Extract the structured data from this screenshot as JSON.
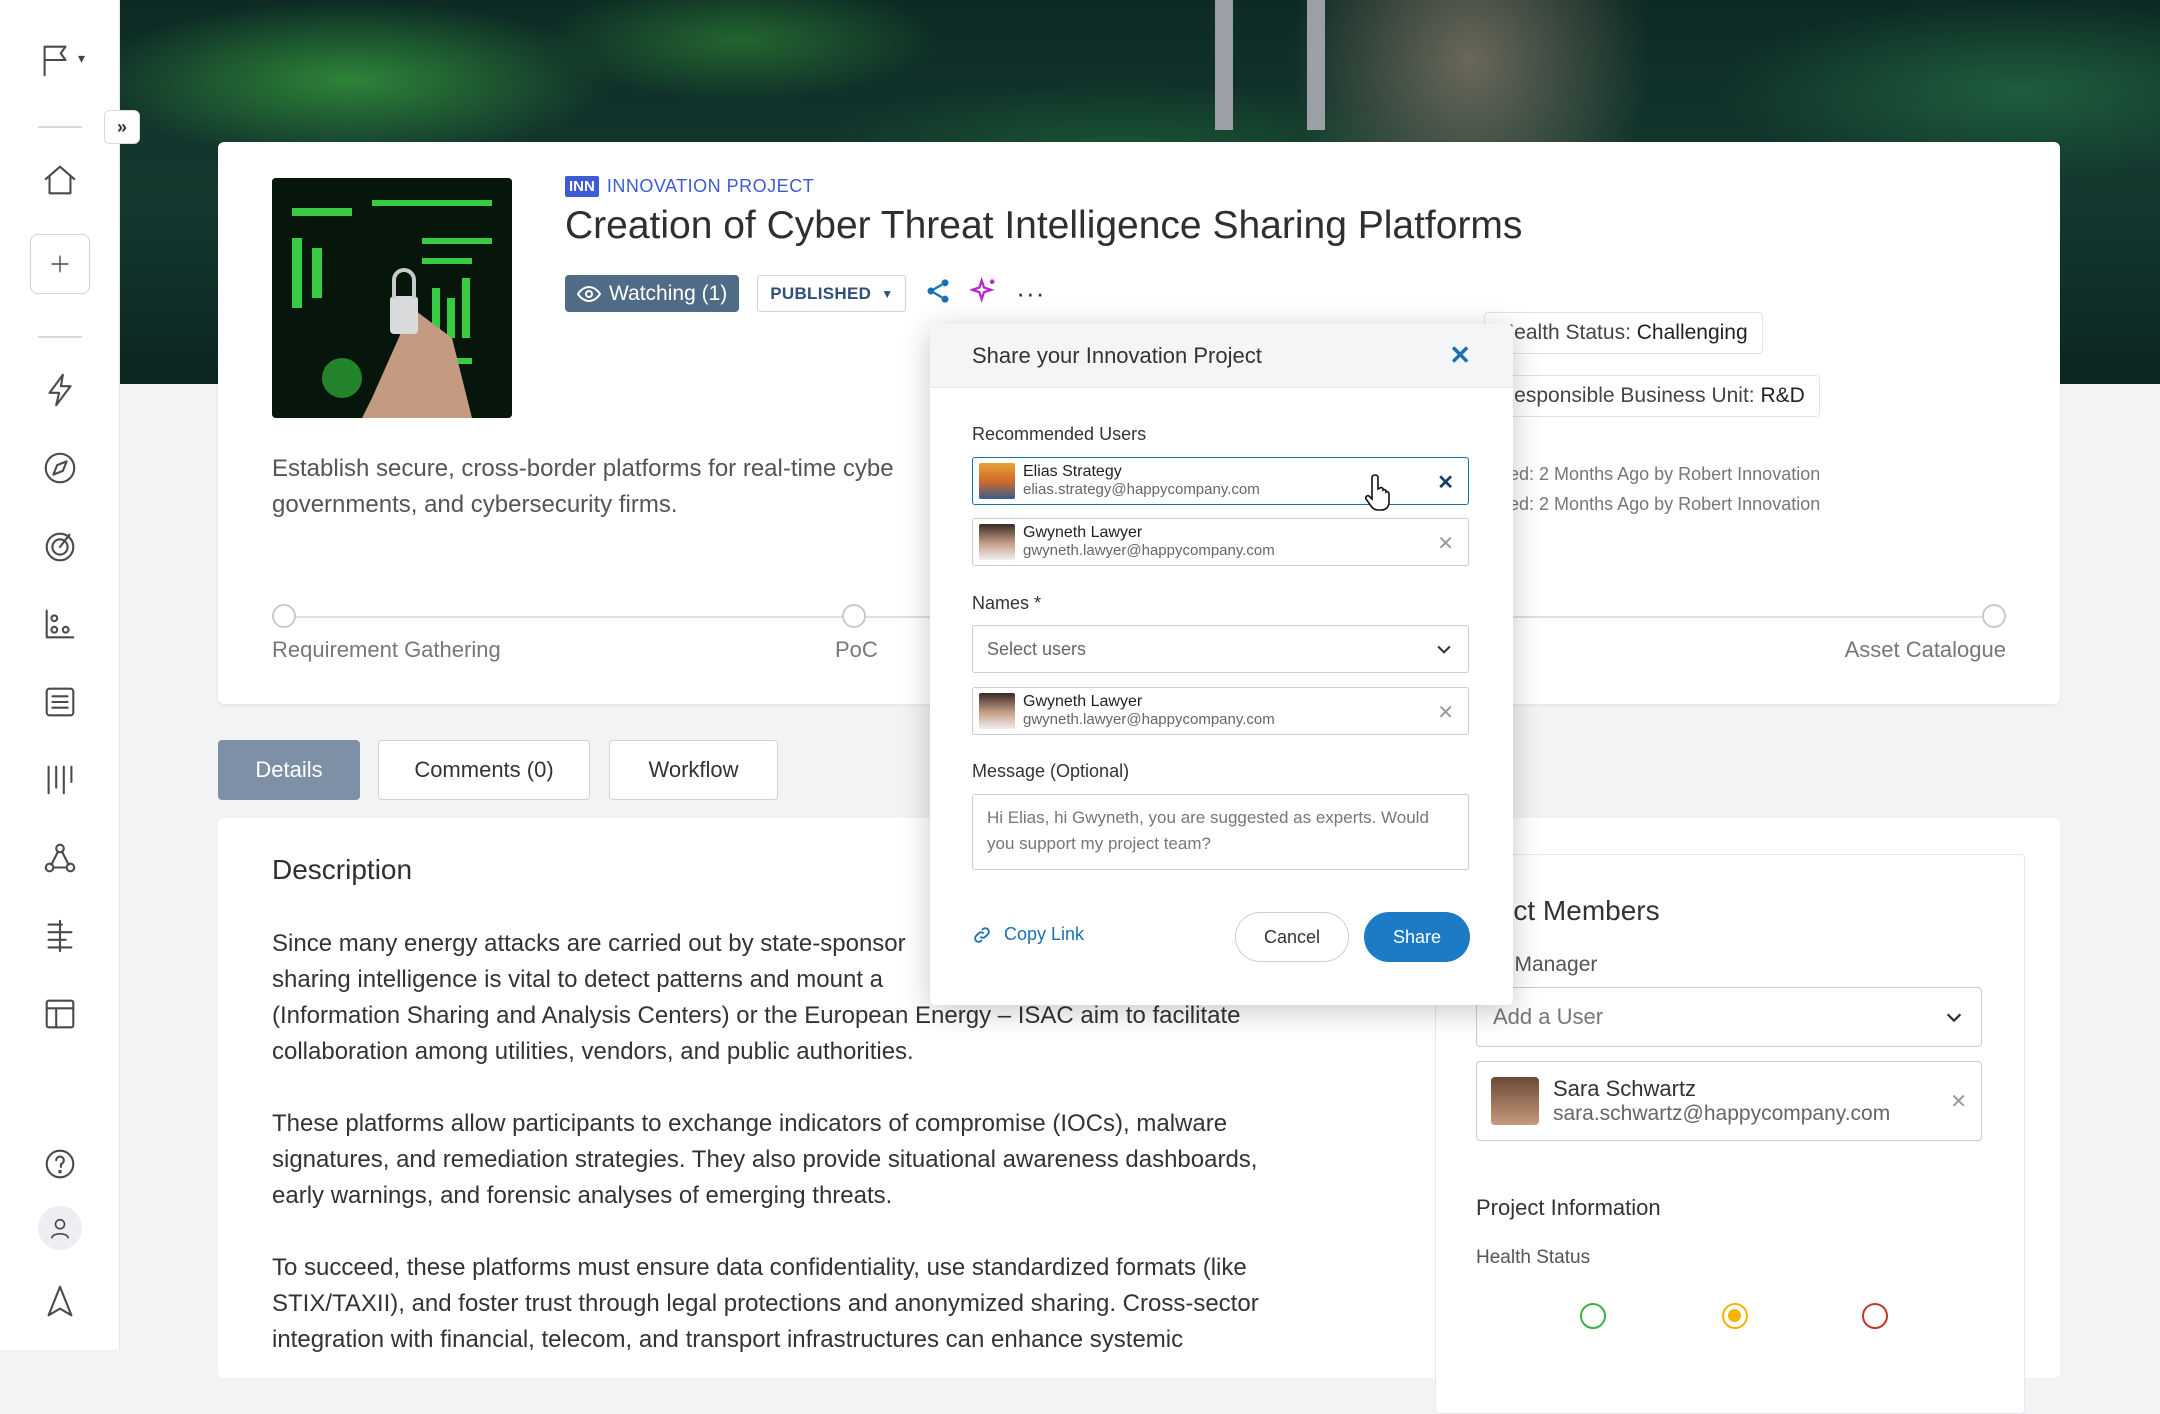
{
  "project": {
    "type_badge": "INN",
    "type_label": "INNOVATION PROJECT",
    "title": "Creation of Cyber Threat Intelligence Sharing Platforms",
    "watch_label": "Watching (1)",
    "status": "PUBLISHED",
    "summary": "Establish secure, cross-border platforms for real-time cyber… governments, and cybersecurity firms.",
    "summary_line1": "Establish secure, cross-border platforms for real-time cybe",
    "summary_line2": "governments, and cybersecurity firms."
  },
  "meta": {
    "health_label": "Health Status:",
    "health_value": "Challenging",
    "bu_label": "Responsible Business Unit:",
    "bu_value": "R&D",
    "created": "eated: 2 Months Ago by Robert Innovation",
    "updated": "dated: 2 Months Ago by Robert Innovation"
  },
  "stages": [
    "Requirement Gathering",
    "PoC",
    "Asset Catalogue"
  ],
  "tabs": {
    "details": "Details",
    "comments": "Comments (0)",
    "workflow": "Workflow"
  },
  "description": {
    "title": "Description",
    "para1": "Since many energy attacks are carried out by state-sponsor… sharing intelligence is vital to detect patterns and mount a … (Information Sharing and Analysis Centers) or the European Energy – ISAC aim to facilitate collaboration among utilities, vendors, and public authorities.",
    "para1_lines": [
      "Since many energy attacks are carried out by state-sponsor",
      "sharing intelligence is vital to detect patterns and mount a",
      "(Information Sharing and Analysis Centers) or the European Energy – ISAC aim to facilitate",
      "collaboration among utilities, vendors, and public authorities."
    ],
    "para2_lines": [
      "These platforms allow participants to exchange indicators of compromise (IOCs), malware",
      "signatures, and remediation strategies. They also provide situational awareness dashboards,",
      "early warnings, and forensic analyses of emerging threats."
    ],
    "para3_lines": [
      "To succeed, these platforms must ensure data confidentiality, use standardized formats (like",
      "STIX/TAXII), and foster trust through legal protections and anonymized sharing. Cross-sector",
      "integration with financial, telecom, and transport infrastructures can enhance systemic"
    ]
  },
  "side": {
    "members_title": "oject Members",
    "pm_label": "ject Manager",
    "pm_placeholder": "Add a User",
    "pm_name": "Sara Schwartz",
    "pm_email": "sara.schwartz@happycompany.com",
    "info_title": "Project Information",
    "hs_label": "Health Status"
  },
  "modal": {
    "title": "Share your Innovation Project",
    "recommended_label": "Recommended Users",
    "recommended": [
      {
        "name": "Elias Strategy",
        "email": "elias.strategy@happycompany.com"
      },
      {
        "name": "Gwyneth Lawyer",
        "email": "gwyneth.lawyer@happycompany.com"
      }
    ],
    "names_label": "Names *",
    "names_placeholder": "Select users",
    "selected": [
      {
        "name": "Gwyneth Lawyer",
        "email": "gwyneth.lawyer@happycompany.com"
      }
    ],
    "message_label": "Message (Optional)",
    "message_text": "Hi Elias, hi Gwyneth, you are suggested as experts. Would you support my project team?",
    "copy_link": "Copy Link",
    "cancel": "Cancel",
    "share": "Share"
  },
  "colors": {
    "accent": "#1b7bc6",
    "brand": "#3e5bd6",
    "health_green": "#3cb043",
    "health_amber": "#f4b400",
    "health_red": "#c0392b"
  }
}
